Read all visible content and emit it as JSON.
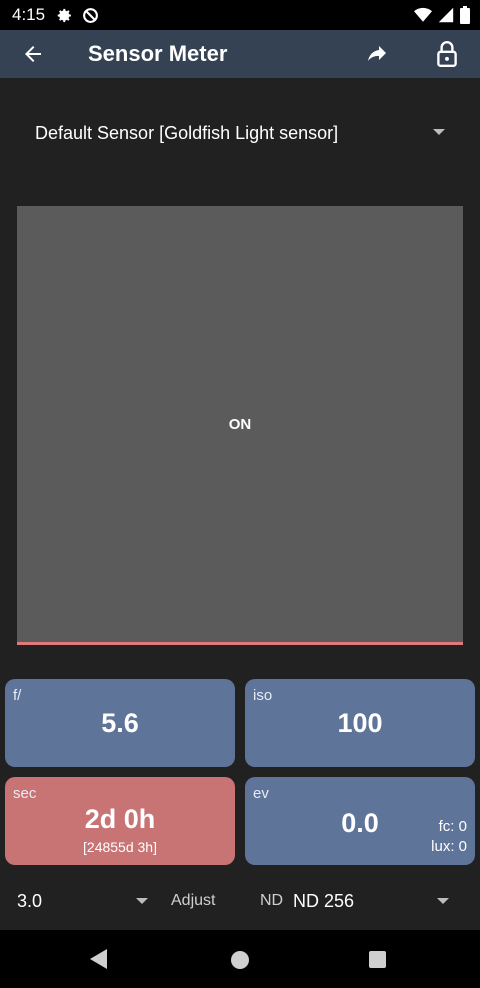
{
  "status_bar": {
    "time": "4:15",
    "icons": [
      "gear-icon",
      "no-disturb-icon",
      "wifi-icon",
      "signal-icon",
      "battery-icon"
    ]
  },
  "app_bar": {
    "title": "Sensor Meter",
    "icons": [
      "back-arrow-icon",
      "share-icon",
      "lock-icon"
    ],
    "color": "#344253"
  },
  "sensor_select": {
    "value": "Default Sensor [Goldfish Light sensor]"
  },
  "meter_panel": {
    "state": "ON",
    "color": "#5b5b5b",
    "indicator_color": "#e07a7a"
  },
  "cards": {
    "aperture": {
      "label": "f/",
      "value": "5.6",
      "color": "#5f7499"
    },
    "iso": {
      "label": "iso",
      "value": "100",
      "color": "#5f7499"
    },
    "shutter": {
      "label": "sec",
      "value": "2d 0h",
      "sub": "[24855d 3h]",
      "color": "#c87374"
    },
    "ev": {
      "label": "ev",
      "value": "0.0",
      "fc": "fc: 0",
      "lux": "lux: 0",
      "color": "#5f7499"
    }
  },
  "controls": {
    "stop_value": "3.0",
    "adjust_label": "Adjust",
    "nd_label": "ND",
    "nd_value": "ND 256"
  },
  "nav_bar": {
    "icons": [
      "nav-back-icon",
      "nav-home-icon",
      "nav-recents-icon"
    ]
  }
}
